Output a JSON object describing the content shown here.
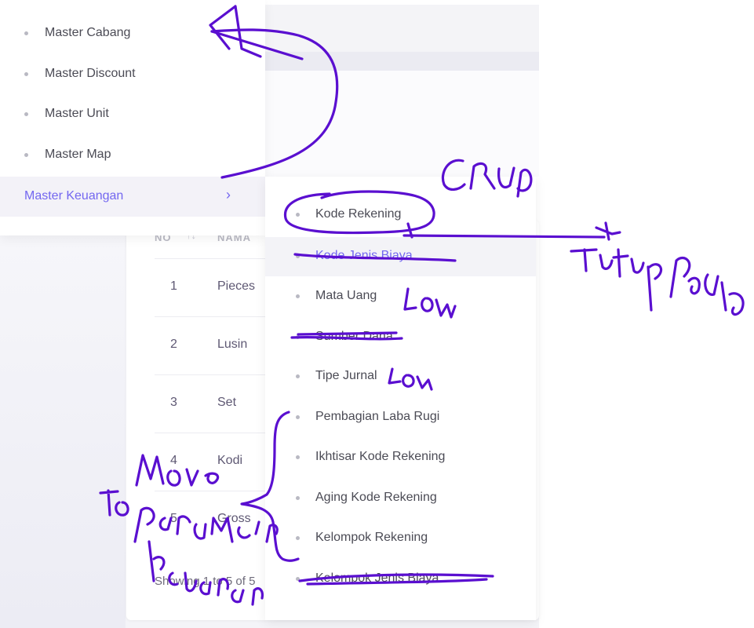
{
  "table": {
    "header_no": "NO",
    "header_name": "NAMA",
    "rows": [
      {
        "no": "1",
        "name": "Pieces"
      },
      {
        "no": "2",
        "name": "Lusin"
      },
      {
        "no": "3",
        "name": "Set"
      },
      {
        "no": "4",
        "name": "Kodi"
      },
      {
        "no": "5",
        "name": "Gross"
      }
    ],
    "footer": "Showing 1 to 5 of 5"
  },
  "menu_master": {
    "items": [
      "Master Cabang",
      "Master Discount",
      "Master Unit",
      "Master Map"
    ],
    "active_label": "Master Keuangan"
  },
  "submenu_keuangan": {
    "items": [
      "Kode Rekening",
      "Kode Jenis Biaya",
      "Mata Uang",
      "Sumber Dana",
      "Tipe Jurnal",
      "Pembagian Laba Rugi",
      "Ikhtisar Kode Rekening",
      "Aging Kode Rekening",
      "Kelompok Rekening",
      "Kelompok Jenis Biaya"
    ],
    "highlighted_index": 1
  },
  "colors": {
    "accent": "#7367f0",
    "ink": "#5a0fd0"
  },
  "icons": {
    "bullet": "dot-icon",
    "chevron": "chevron-right-icon",
    "sort": "sort-icon"
  }
}
